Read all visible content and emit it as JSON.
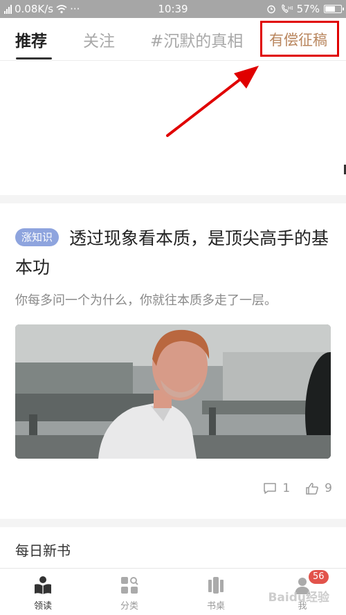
{
  "status_bar": {
    "network_speed": "0.08K/s",
    "dots": "···",
    "time": "10:39",
    "battery": "57%",
    "battery_level": 0.57
  },
  "tabs": [
    {
      "label": "推荐",
      "active": true
    },
    {
      "label": "关注",
      "active": false
    },
    {
      "label": "#沉默的真相",
      "active": false
    },
    {
      "label": "有偿征稿",
      "active": false,
      "color": "#b9865e"
    }
  ],
  "annotation": {
    "box_color": "#e00000",
    "arrow_color": "#e00000"
  },
  "article": {
    "tag": "涨知识",
    "title": "透过现象看本质，是顶尖高手的基本功",
    "subtitle": "你每多问一个为什么，你就往本质多走了一层。",
    "comments": "1",
    "likes": "9"
  },
  "section_title": "每日新书",
  "bottom_nav": [
    {
      "label": "领读",
      "icon": "book-reader-icon",
      "active": true
    },
    {
      "label": "分类",
      "icon": "category-search-icon",
      "active": false
    },
    {
      "label": "书桌",
      "icon": "bookshelf-icon",
      "active": false
    },
    {
      "label": "我",
      "icon": "profile-icon",
      "active": false,
      "badge": "56"
    }
  ],
  "watermark": "Baidu经验"
}
